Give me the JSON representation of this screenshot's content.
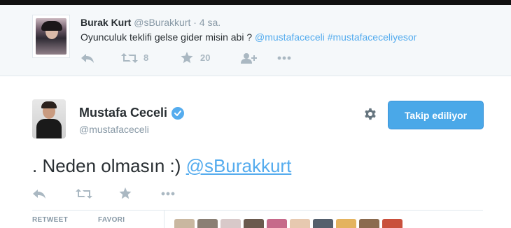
{
  "reply_tweet": {
    "name": "Burak Kurt",
    "handle": "@sBurakkurt",
    "separator": "·",
    "time": "4 sa.",
    "text": "Oyunculuk teklifi gelse gider misin abi ? ",
    "mention": "@mustafaceceli",
    "hashtag": "#mustafaceceliyesor",
    "retweet_count": "8",
    "favorite_count": "20"
  },
  "main_tweet": {
    "name": "Mustafa Ceceli",
    "handle": "@mustafaceceli",
    "follow_button": "Takip ediliyor",
    "text_prefix": ". Neden olmasın :) ",
    "mention": "@sBurakkurt"
  },
  "stats": {
    "retweet_label": "RETWEET",
    "favorite_label": "FAVORI"
  },
  "icons": {
    "reply": "reply-icon",
    "retweet": "retweet-icon",
    "favorite": "star-icon",
    "follow": "follow-user-icon",
    "more": "more-icon",
    "settings": "gear-icon",
    "verified": "verified-icon"
  },
  "colors": {
    "link": "#55acee",
    "follow_button": "#4aa8e8",
    "icon_gray": "#aab8c2",
    "muted_text": "#8899a6"
  },
  "favoriters_avatar_colors": [
    "#c9b7a0",
    "#8a7f74",
    "#d8c9c9",
    "#6b5a4e",
    "#c66a8a",
    "#e7c9b0",
    "#55606d",
    "#e4b35f",
    "#8b6b4f",
    "#c9503c"
  ]
}
